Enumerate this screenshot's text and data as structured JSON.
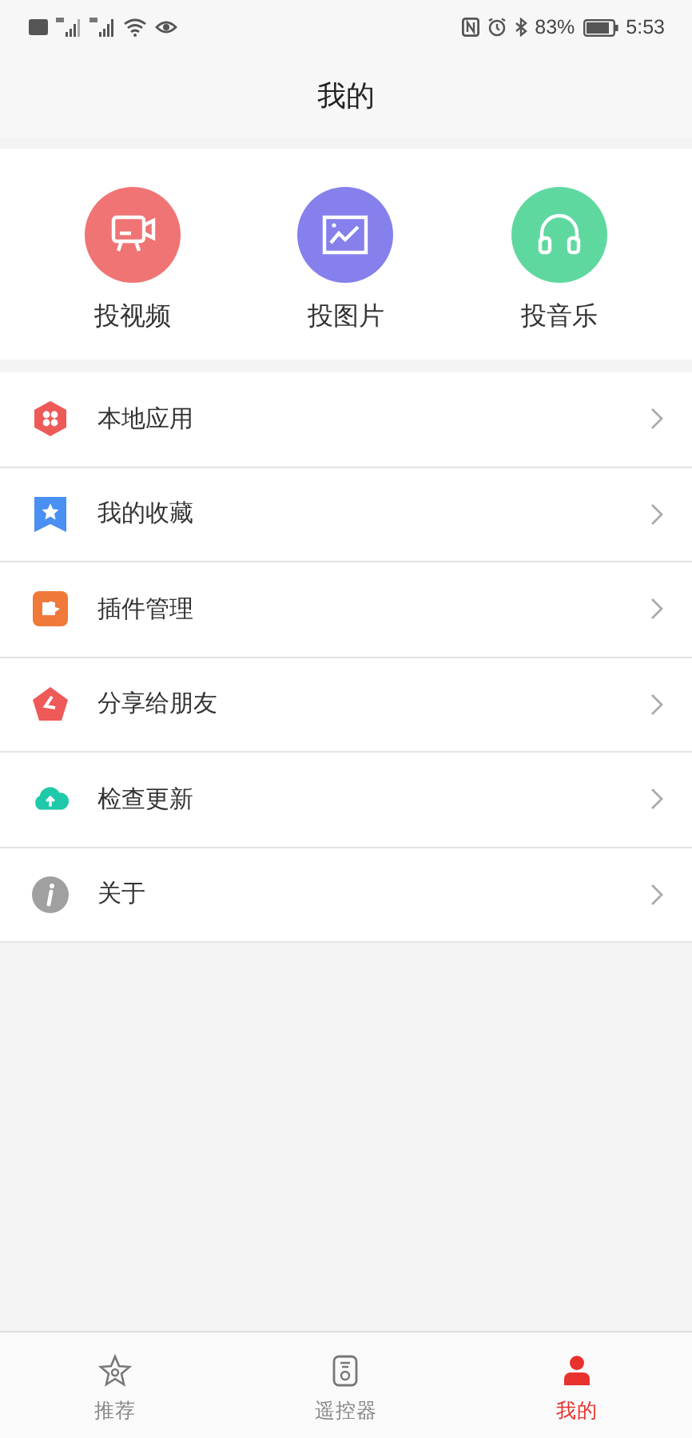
{
  "status_bar": {
    "battery_text": "83%",
    "time": "5:53"
  },
  "header": {
    "title": "我的"
  },
  "quick_actions": [
    {
      "label": "投视频",
      "kind": "video",
      "color": "#f07474"
    },
    {
      "label": "投图片",
      "kind": "picture",
      "color": "#8580ec"
    },
    {
      "label": "投音乐",
      "kind": "music",
      "color": "#5fd8a0"
    }
  ],
  "menu": [
    {
      "label": "本地应用",
      "kind": "apps"
    },
    {
      "label": "我的收藏",
      "kind": "favorites"
    },
    {
      "label": "插件管理",
      "kind": "plugins"
    },
    {
      "label": "分享给朋友",
      "kind": "share"
    },
    {
      "label": "检查更新",
      "kind": "update"
    },
    {
      "label": "关于",
      "kind": "about"
    }
  ],
  "tabs": [
    {
      "label": "推荐",
      "kind": "recommend",
      "selected": false
    },
    {
      "label": "遥控器",
      "kind": "remote",
      "selected": false
    },
    {
      "label": "我的",
      "kind": "me",
      "selected": true
    }
  ]
}
